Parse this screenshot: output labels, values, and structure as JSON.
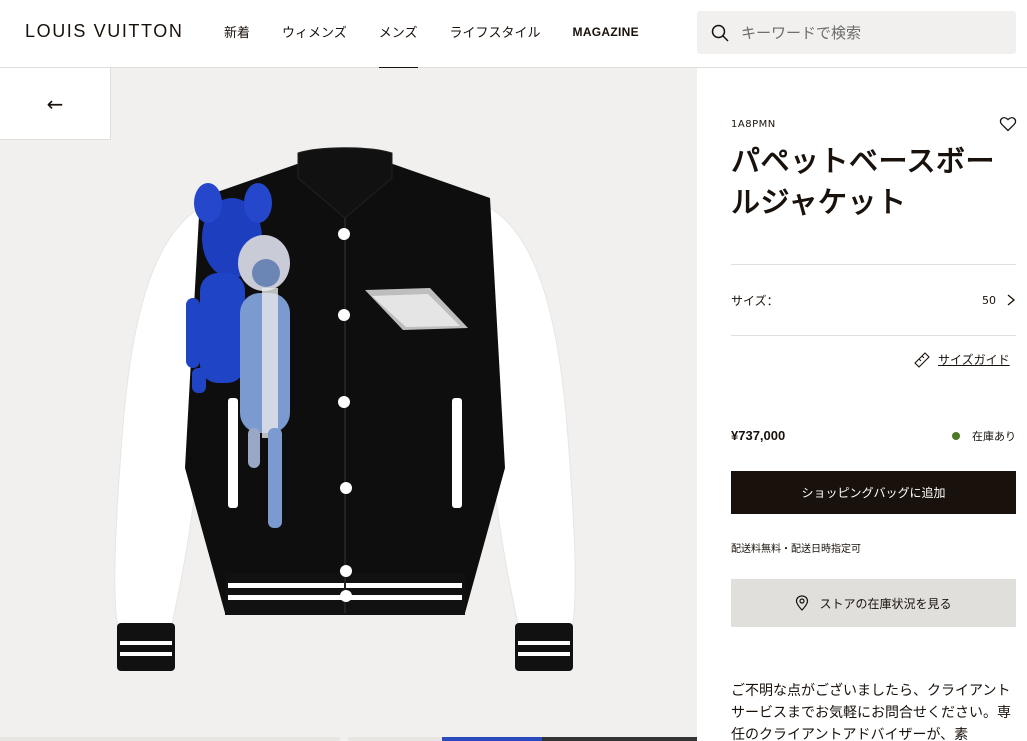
{
  "header": {
    "logo": "LOUIS VUITTON",
    "nav": [
      "新着",
      "ウィメンズ",
      "メンズ",
      "ライフスタイル",
      "MAGAZINE"
    ],
    "active_nav": "メンズ",
    "search_placeholder": "キーワードで検索"
  },
  "gallery": {
    "back_label": "←"
  },
  "product": {
    "sku": "1A8PMN",
    "name": "パペットベースボールジャケット",
    "size_label": "サイズ：",
    "size_value": "50",
    "size_guide": "サイズガイド",
    "price": "¥737,000",
    "stock": "在庫あり",
    "add_to_bag": "ショッピングバッグに追加",
    "shipping_note": "配送料無料・配送日時指定可",
    "store_stock": "ストアの在庫状況を見る",
    "help_text": "ご不明な点がございましたら、クライアントサービスまでお気軽にお問合せください。専任のクライアントアドバイザーが、素"
  },
  "colors": {
    "text": "#19110b",
    "background_gray": "#f1f0ee",
    "divider": "#e1dfdb",
    "in_stock": "#4e7a26"
  }
}
